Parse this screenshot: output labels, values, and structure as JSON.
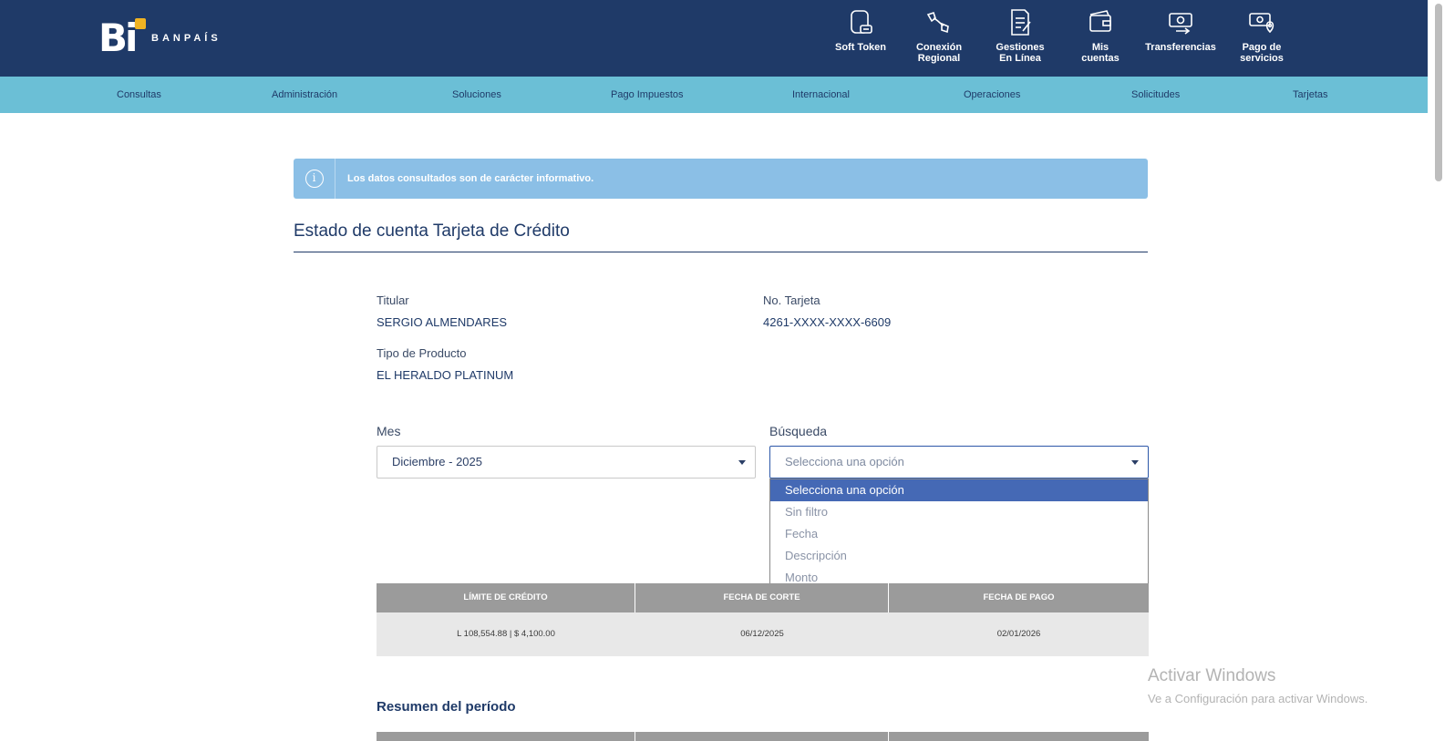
{
  "brand": {
    "mark": "Bi",
    "name": "BANPAÍS",
    "accent": "#f0b323",
    "header_color": "#1f3a68",
    "nav_color": "#6bbfd6"
  },
  "quick_actions": [
    {
      "label": "Soft Token",
      "icon": "soft-token-icon"
    },
    {
      "label": "Conexión\nRegional",
      "icon": "regional-connection-icon"
    },
    {
      "label": "Gestiones\nEn Línea",
      "icon": "online-requests-icon"
    },
    {
      "label": "Mis\ncuentas",
      "icon": "wallet-icon"
    },
    {
      "label": "Transferencias",
      "icon": "transfer-icon"
    },
    {
      "label": "Pago de\nservicios",
      "icon": "bill-payment-icon"
    }
  ],
  "nav": [
    "Consultas",
    "Administración",
    "Soluciones",
    "Pago Impuestos",
    "Internacional",
    "Operaciones",
    "Solicitudes",
    "Tarjetas"
  ],
  "info_banner": {
    "text": "Los datos consultados son de carácter informativo.",
    "icon": "info-icon"
  },
  "page_title": "Estado de cuenta Tarjeta de Crédito",
  "account": {
    "holder_label": "Titular",
    "holder_value": "SERGIO ALMENDARES",
    "card_label": "No. Tarjeta",
    "card_value": "4261-XXXX-XXXX-6609",
    "product_label": "Tipo de Producto",
    "product_value": "EL HERALDO PLATINUM"
  },
  "filters": {
    "month_label": "Mes",
    "month_value": "Diciembre - 2025",
    "search_label": "Búsqueda",
    "search_value": "Selecciona una opción",
    "search_options": [
      "Selecciona una opción",
      "Sin filtro",
      "Fecha",
      "Descripción",
      "Monto"
    ]
  },
  "summary_table": {
    "headers": [
      "LÍMITE DE CRÉDITO",
      "FECHA DE CORTE",
      "FECHA DE PAGO"
    ],
    "row": [
      "L 108,554.88 | $ 4,100.00",
      "06/12/2025",
      "02/01/2026"
    ]
  },
  "period_title": "Resumen del período",
  "watermark": {
    "title": "Activar Windows",
    "subtitle": "Ve a Configuración para activar Windows."
  }
}
